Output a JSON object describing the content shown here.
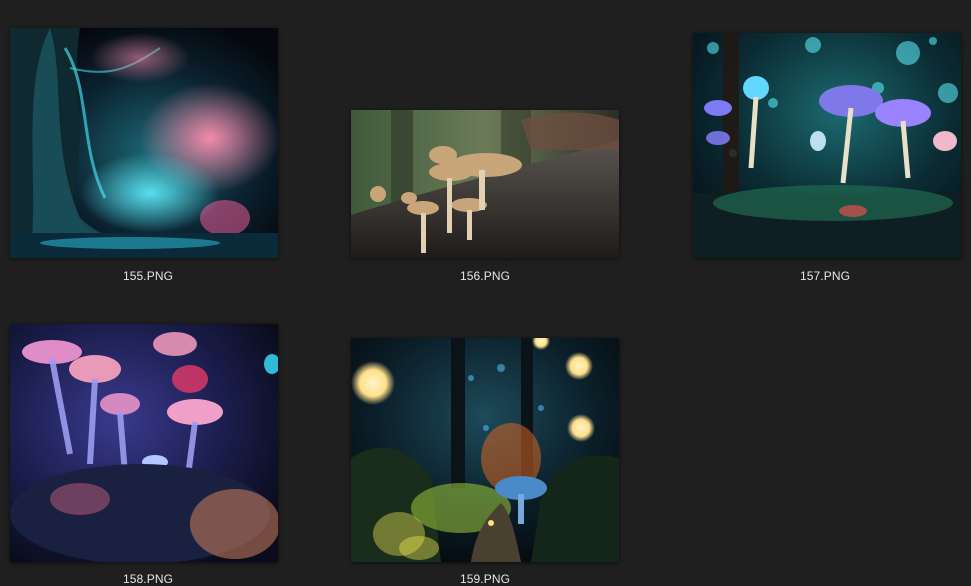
{
  "files": [
    {
      "name": "155.PNG",
      "image": "glowing-fantasy-forest-tree-image"
    },
    {
      "name": "156.PNG",
      "image": "mushrooms-on-log-image"
    },
    {
      "name": "157.PNG",
      "image": "bioluminescent-mushroom-forest-image"
    },
    {
      "name": "158.PNG",
      "image": "neon-pink-mushrooms-image"
    },
    {
      "name": "159.PNG",
      "image": "forest-path-glowing-lights-image"
    }
  ]
}
